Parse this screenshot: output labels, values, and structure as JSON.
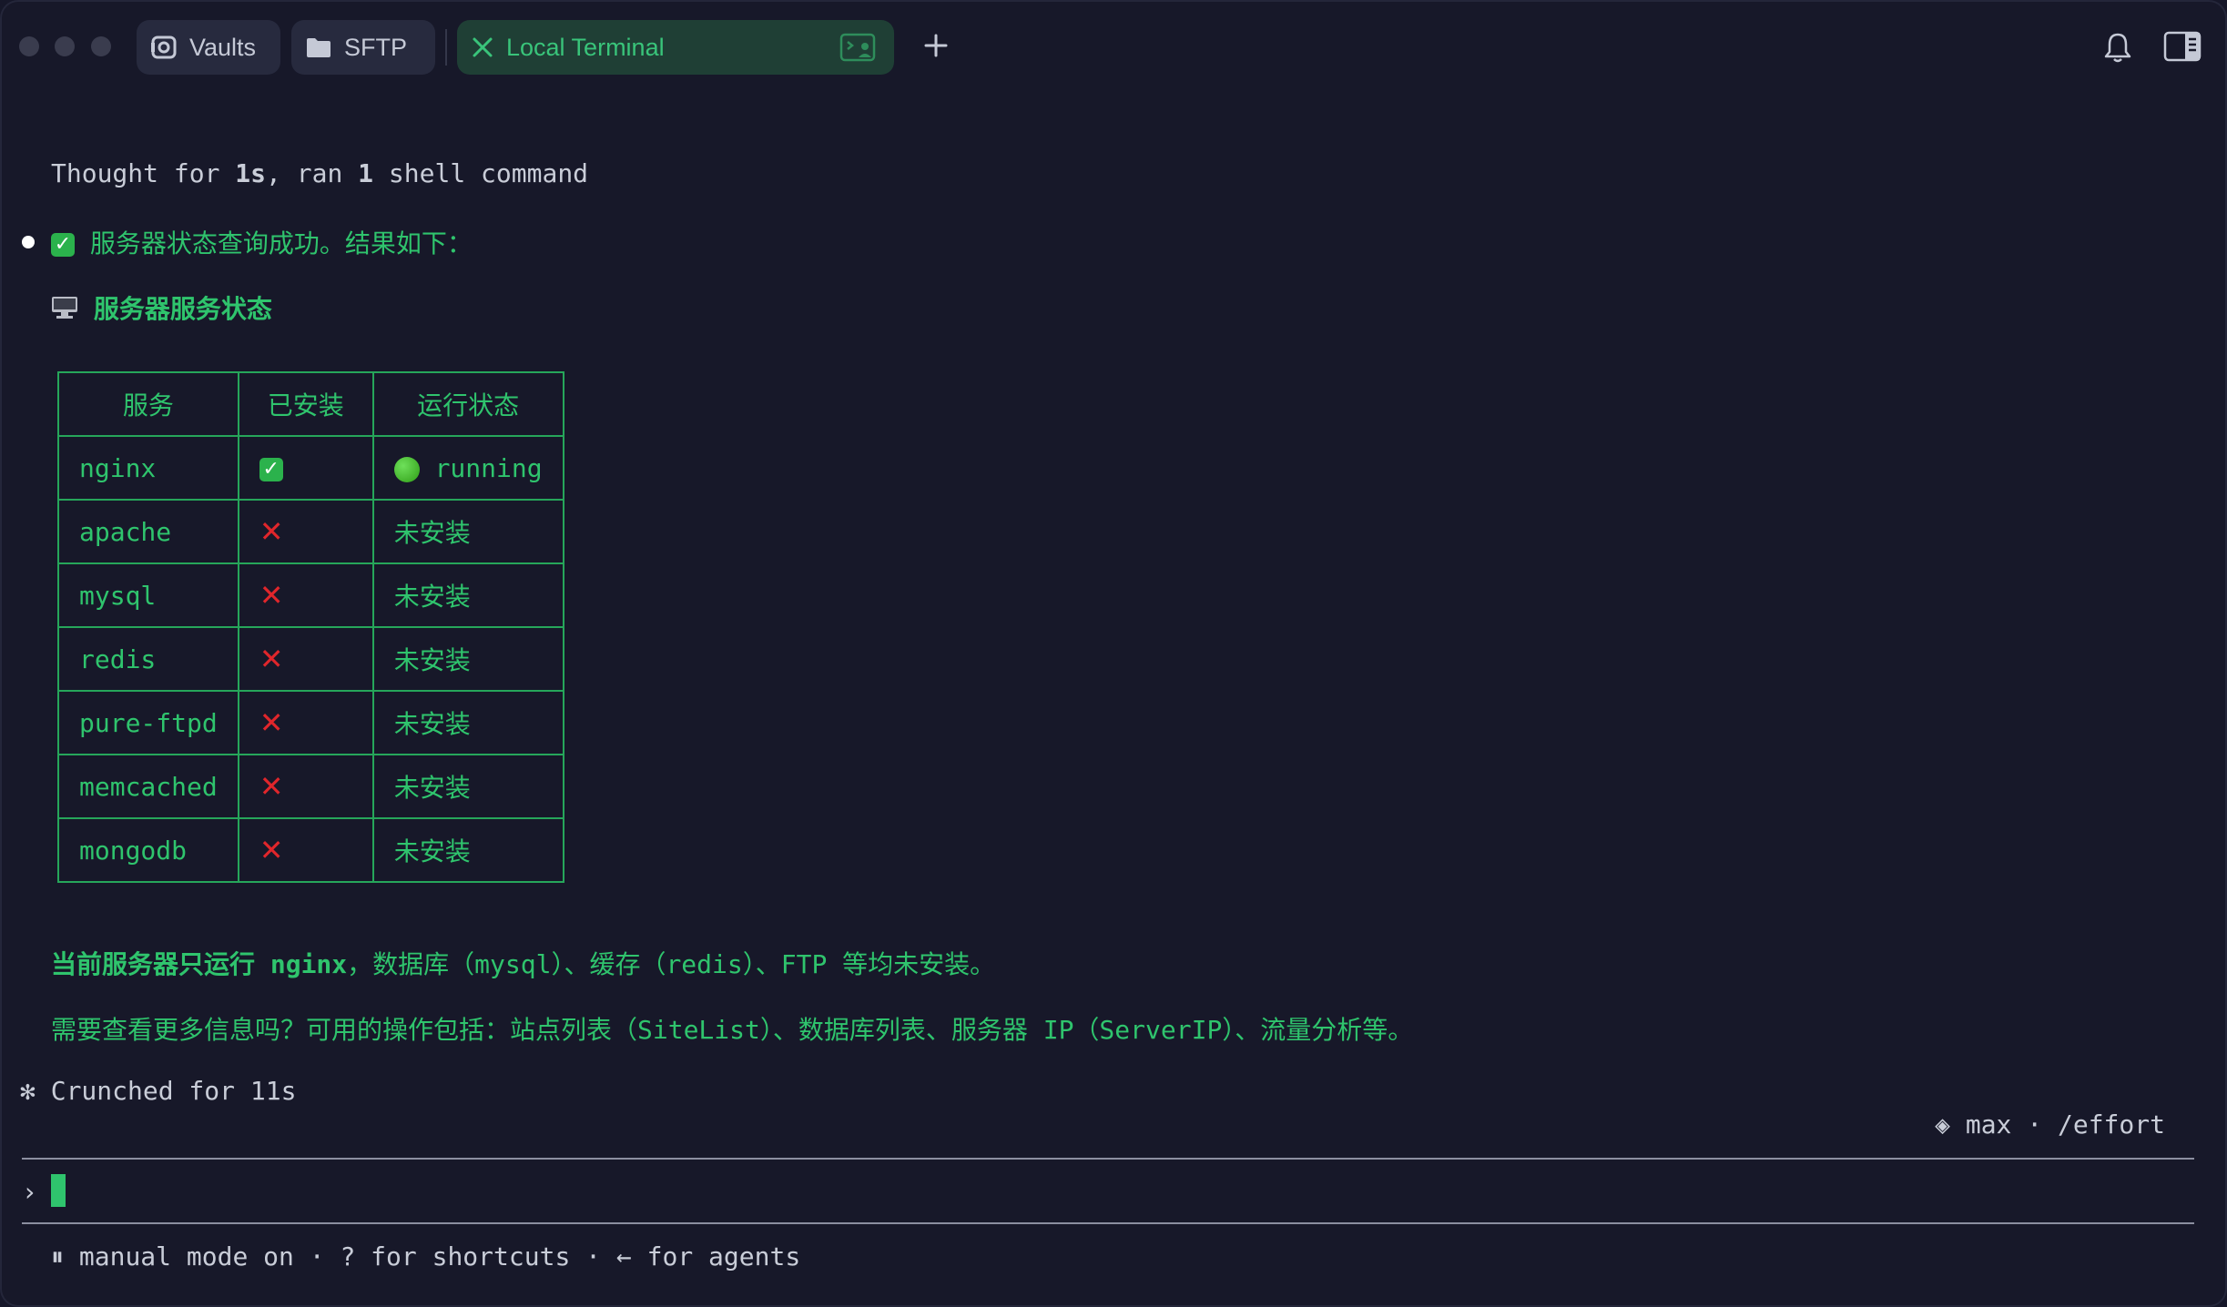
{
  "tabs": [
    {
      "label": "Vaults",
      "icon": "vault-icon"
    },
    {
      "label": "SFTP",
      "icon": "folder-icon"
    },
    {
      "label": "Local Terminal",
      "icon": "close-icon",
      "active": true
    }
  ],
  "terminal": {
    "thought": {
      "prefix": "Thought for ",
      "duration": "1s",
      "mid": ", ran ",
      "count": "1",
      "suffix": " shell command"
    },
    "success_line": "服务器状态查询成功。结果如下：",
    "section_title": "服务器服务状态",
    "table": {
      "headers": [
        "服务",
        "已安装",
        "运行状态"
      ],
      "rows": [
        {
          "service": "nginx",
          "installed": "yes",
          "status": "running"
        },
        {
          "service": "apache",
          "installed": "no",
          "status": "未安装"
        },
        {
          "service": "mysql",
          "installed": "no",
          "status": "未安装"
        },
        {
          "service": "redis",
          "installed": "no",
          "status": "未安装"
        },
        {
          "service": "pure-ftpd",
          "installed": "no",
          "status": "未安装"
        },
        {
          "service": "memcached",
          "installed": "no",
          "status": "未安装"
        },
        {
          "service": "mongodb",
          "installed": "no",
          "status": "未安装"
        }
      ]
    },
    "summary": {
      "prefix": "当前服务器只运行 ",
      "highlight": "nginx",
      "rest": "，数据库（mysql）、缓存（redis）、FTP 等均未安装。"
    },
    "followup": "需要查看更多信息吗？可用的操作包括：站点列表（SiteList）、数据库列表、服务器 IP（ServerIP）、流量分析等。",
    "crunched": "Crunched for 11s",
    "effort": "◈ max · /effort",
    "prompt_symbol": "›",
    "footer": "manual mode on · ? for shortcuts · ← for agents"
  },
  "colors": {
    "accent": "#2fc46d",
    "background": "#171829",
    "error": "#e0262b"
  }
}
